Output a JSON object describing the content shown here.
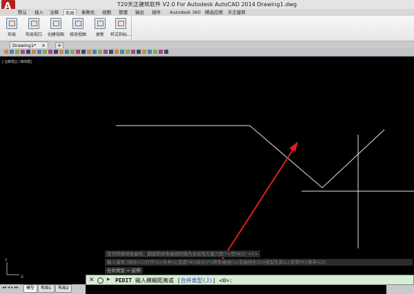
{
  "window": {
    "title": "T20天正建筑软件 V2.0 For Autodesk AutoCAD 2014    Drawing1.dwg",
    "app_logo": "A"
  },
  "ribbon_tabs": [
    "默认",
    "插入",
    "注释",
    "布局",
    "参数化",
    "视图",
    "管理",
    "输出",
    "插件",
    "Autodesk 360",
    "精选应用",
    "天正建筑"
  ],
  "active_tab": "布局",
  "ribbon_buttons": [
    "布局",
    "布局视口",
    "创建视图",
    "修改视图",
    "更新",
    "样式和标..."
  ],
  "doc_tab": {
    "label": "Drawing1*",
    "close": "×",
    "new": "+"
  },
  "viewport_label": "[-][俯视][二维线框]",
  "command_history": [
    "是否转换样条曲线、圆弧和样条曲线转换为多段线方案?[是(Y)/否(N)]? <Y>",
    "输入选项 [闭合(C)/打开(O)/合并(J)/宽度(W)/拟合(F)/样条曲线(S)/非曲线化(D)/线型生成(L)/反转(R)/放弃(U)]:",
    "合并类型 = 延伸"
  ],
  "command_line": {
    "close": "✕",
    "prompt_arrow": "▸",
    "command": "PEDIT",
    "text": "输入模糊距离或 [",
    "option": "合并类型(J)",
    "suffix": "] <0>:"
  },
  "layout_tabs": [
    "模型",
    "布局1",
    "布局2"
  ],
  "active_layout": "模型",
  "ucs": {
    "x": "X",
    "y": "Y"
  },
  "colors": {
    "canvas": "#000000",
    "lines": "#e6e6e6",
    "annotation_arrow": "#e02020",
    "command_bg": "#d9ecd6",
    "option_text": "#2f46c8"
  }
}
